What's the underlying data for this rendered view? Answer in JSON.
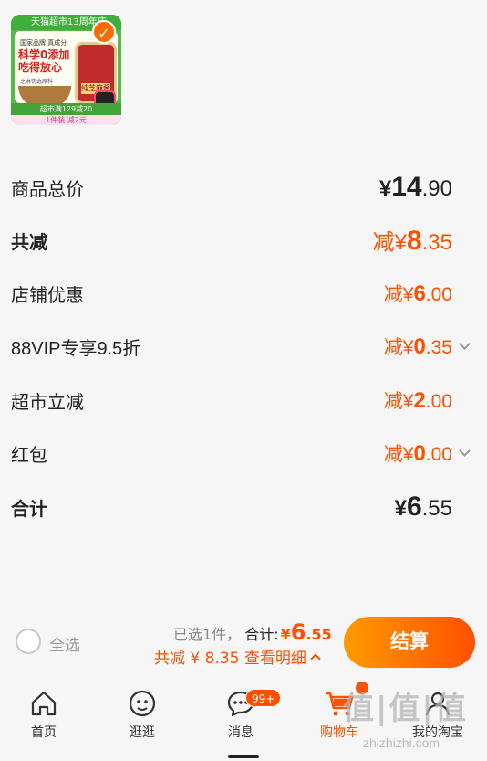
{
  "product": {
    "banner": "天猫超市13周年庆",
    "line1": "国家品牌 真成分",
    "headline": "科学0添加 吃得放心",
    "line2": "芝麻优选原料",
    "jar_label": "纯芝麻酱",
    "promo": "超市满129减20",
    "footer": "1件装 减2元"
  },
  "rows": {
    "total_goods": {
      "label": "商品总价",
      "yen": "¥",
      "int": "14",
      "dec": ".90"
    },
    "total_discount": {
      "label": "共减",
      "prefix": "减¥",
      "int": "8",
      "dec": ".35"
    },
    "store_coupon": {
      "label": "店铺优惠",
      "prefix": "减¥",
      "int": "6",
      "dec": ".00"
    },
    "vip": {
      "label": "88VIP专享9.5折",
      "prefix": "减¥",
      "int": "0",
      "dec": ".35"
    },
    "supermarket": {
      "label": "超市立减",
      "prefix": "减¥",
      "int": "2",
      "dec": ".00"
    },
    "red_packet": {
      "label": "红包",
      "prefix": "减¥",
      "int": "0",
      "dec": ".00"
    },
    "total": {
      "label": "合计",
      "yen": "¥",
      "int": "6",
      "dec": ".55"
    }
  },
  "checkout": {
    "select_all": "全选",
    "selected_count": "已选1件，",
    "total_label": "合计:",
    "total_yen": "¥",
    "total_int": "6",
    "total_dec": ".55",
    "discount_summary": "共减 ¥ 8.35 查看明细",
    "button": "结算"
  },
  "tabbar": {
    "home": "首页",
    "browse": "逛逛",
    "messages": "消息",
    "messages_badge": "99+",
    "cart": "购物车",
    "mine": "我的淘宝"
  },
  "watermark": {
    "text": "值|值|值",
    "url": "zhizhizhi.com"
  },
  "colors": {
    "accent": "#ff5000",
    "accent_start": "#ff9a00"
  }
}
